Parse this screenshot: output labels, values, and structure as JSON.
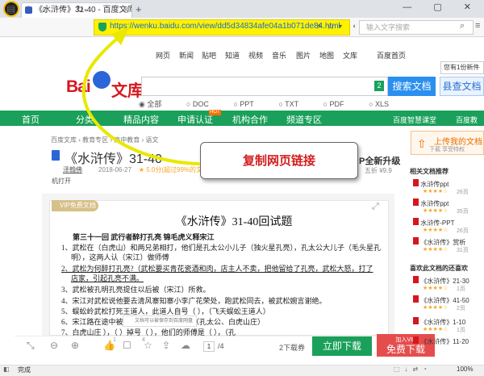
{
  "browser": {
    "tab_title": "《水浒传》31-40 - 百度文库",
    "tab_close": "×",
    "new_tab": "+",
    "url": "https://wenku.baidu.com/view/dd5d34834afe04a1b071de84.html",
    "search_placeholder": "输入文字搜索",
    "status": "完成",
    "zoom": "100%"
  },
  "topnav": [
    "网页",
    "新闻",
    "贴吧",
    "知道",
    "视频",
    "音乐",
    "图片",
    "地图",
    "文库",
    "百度首页"
  ],
  "notice": "您有1份新件",
  "logo": {
    "bai": "Bai",
    "wenku": "文库"
  },
  "search": {
    "badge": "2",
    "button": "搜索文档",
    "button2": "县查文档"
  },
  "filters": [
    "全部",
    "DOC",
    "PPT",
    "TXT",
    "PDF",
    "XLS"
  ],
  "greennav": [
    "首页",
    "分类",
    "精品内容",
    "申请认证",
    "机构合作",
    "频道专区",
    "百度智慧课堂",
    "百度教"
  ],
  "hot_badge": "HOT",
  "breadcrumb": "百度文库 › 教育专区 › 高中教育 › 语文",
  "doc": {
    "title": "《水浒传》31-40",
    "author": "泽翰佛",
    "date": "2018-06-27",
    "rating": "★ 5.0分(超过99%的文档)",
    "open_hint": "机打开",
    "vip_title": "P全新升级",
    "vip_sub": "五折 ¥9.9",
    "vip_badge": "VIP免费文档",
    "page_title": "《水浒传》31-40回试题",
    "lines": [
      "第三十一回      武行者醉打孔亮   锦毛虎义释宋江",
      "1、武松在（白虎山）和两兄弟相打，他们是孔太公小儿子（独火星孔亮），孔太公大儿子（毛头星孔",
      "明），这两人认（宋江）做师傅",
      "2、武松为何醉打孔亮?（武松要买青花瓷酒和肉，店主人不卖，把他留给了孔亮，武松大怒，打了",
      "店家，引起孔亮不满。",
      "3、武松被孔明孔亮提住以后被（宋江）所救。",
      "4、宋江对武松说他要去清风寨知寨小李广花荣处，跑武松同去，被武松婉言谢绝。",
      "5、蜈蚣岭武松打死王道人，此道人自号（   ），（飞天蜈蚣王道人）",
      "6、宋江路在途中被掳                      来人把他捉到（   ），（孔太公、白虎山庄）",
      "7、白虎山庄                   ），（     ）掉号（     ），他们的师傅是（     ），（孔"
    ],
    "toast": "文档可以被保存到百度网盘"
  },
  "callout": "复制网页链接",
  "toolbar": {
    "page_current": "1",
    "page_total": "/4",
    "rest": "2下载券",
    "download": "立即下载",
    "vip_join": "加入VIP",
    "free_download": "免费下载",
    "like_count": "1",
    "comment_count": "4"
  },
  "sidebar": {
    "upload_title": "上传我的文档",
    "upload_sub": "下载 享受特权",
    "related_header": "相关文档推荐",
    "related": [
      {
        "name": "水浒传ppt",
        "pages": "26页"
      },
      {
        "name": "水浒传ppt",
        "pages": "35页"
      },
      {
        "name": "水浒传-PPT",
        "pages": "26页"
      },
      {
        "name": "《水浒传》赏析",
        "pages": "31页"
      }
    ],
    "like_header": "喜欢此文档的还喜欢",
    "liked": [
      {
        "name": "《水浒传》21-30",
        "pages": "1页"
      },
      {
        "name": "《水浒传》41-50",
        "pages": "2页"
      },
      {
        "name": "《水浒传》1-10",
        "pages": "1页"
      },
      {
        "name": "《水浒传》11-20",
        "pages": ""
      }
    ]
  },
  "colors": {
    "baidu_red": "#d5171f",
    "green": "#1aa05a",
    "blue": "#2b8ff0",
    "url_highlight": "#fff200",
    "arrow": "#e8e800"
  }
}
